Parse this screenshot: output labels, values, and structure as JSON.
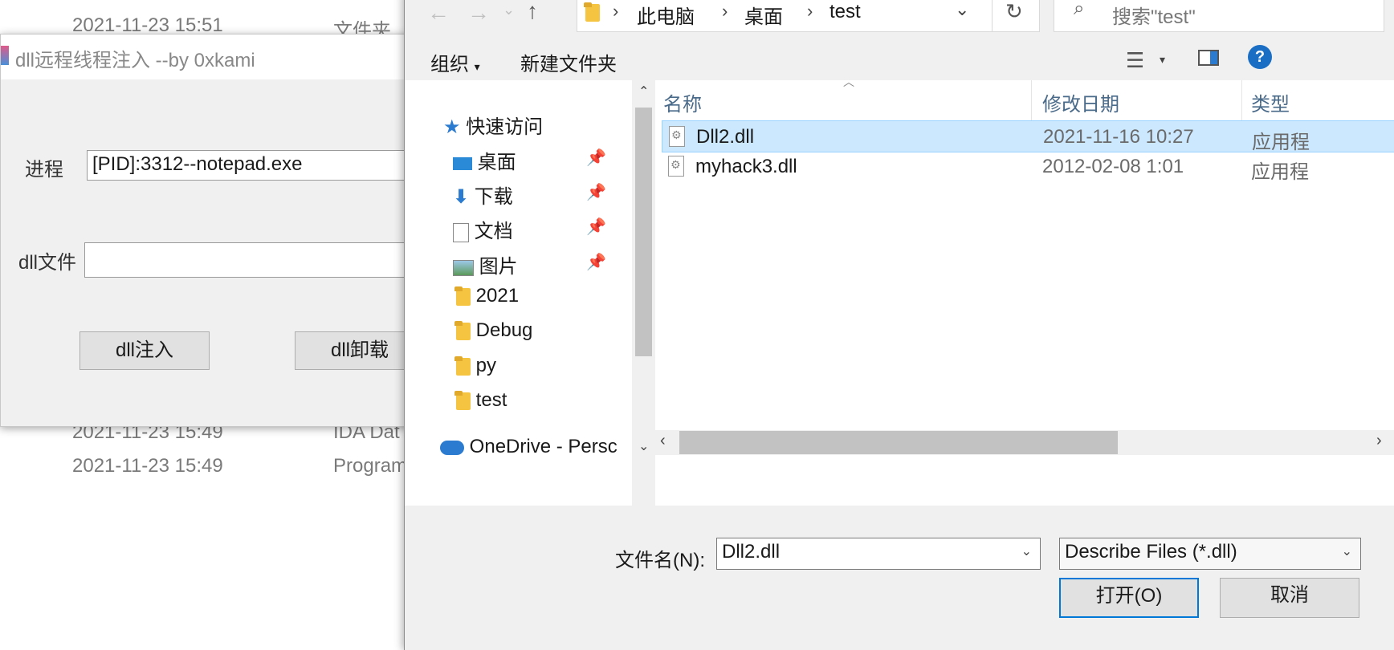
{
  "background_explorer": {
    "rows": [
      {
        "date": "2021-11-23 15:51",
        "type": "文件夹"
      },
      {
        "date": "2021-11-23 15:49",
        "type": "IDA Dat"
      },
      {
        "date": "2021-11-23 15:49",
        "type": "Program"
      }
    ]
  },
  "injector": {
    "title": "dll远程线程注入 --by 0xkami",
    "process_label": "进程",
    "process_value": "[PID]:3312--notepad.exe",
    "dll_label": "dll文件",
    "dll_value": "",
    "inject_button": "dll注入",
    "unload_button": "dll卸载"
  },
  "dialog": {
    "breadcrumb": [
      "此电脑",
      "桌面",
      "test"
    ],
    "search_placeholder": "搜索\"test\"",
    "toolbar": {
      "organize": "组织",
      "new_folder": "新建文件夹",
      "help": "?"
    },
    "nav": {
      "quick_access": "快速访问",
      "items": [
        {
          "label": "桌面",
          "pinned": true,
          "icon": "desktop-icon"
        },
        {
          "label": "下载",
          "pinned": true,
          "icon": "download-icon"
        },
        {
          "label": "文档",
          "pinned": true,
          "icon": "document-icon"
        },
        {
          "label": "图片",
          "pinned": true,
          "icon": "pictures-icon"
        },
        {
          "label": "2021",
          "pinned": false,
          "icon": "folder-icon"
        },
        {
          "label": "Debug",
          "pinned": false,
          "icon": "folder-icon"
        },
        {
          "label": "py",
          "pinned": false,
          "icon": "folder-icon"
        },
        {
          "label": "test",
          "pinned": false,
          "icon": "folder-icon"
        }
      ],
      "onedrive": "OneDrive - Persc"
    },
    "columns": {
      "name": "名称",
      "modified": "修改日期",
      "type": "类型"
    },
    "files": [
      {
        "name": "Dll2.dll",
        "modified": "2021-11-16 10:27",
        "type": "应用程",
        "selected": true
      },
      {
        "name": "myhack3.dll",
        "modified": "2012-02-08 1:01",
        "type": "应用程",
        "selected": false
      }
    ],
    "filename_label": "文件名(N):",
    "filename_value": "Dll2.dll",
    "filter_value": "Describe Files (*.dll)",
    "open_button": "打开(O)",
    "cancel_button": "取消",
    "colors": {
      "selection": "#cce8ff",
      "accent": "#0078d7"
    }
  }
}
